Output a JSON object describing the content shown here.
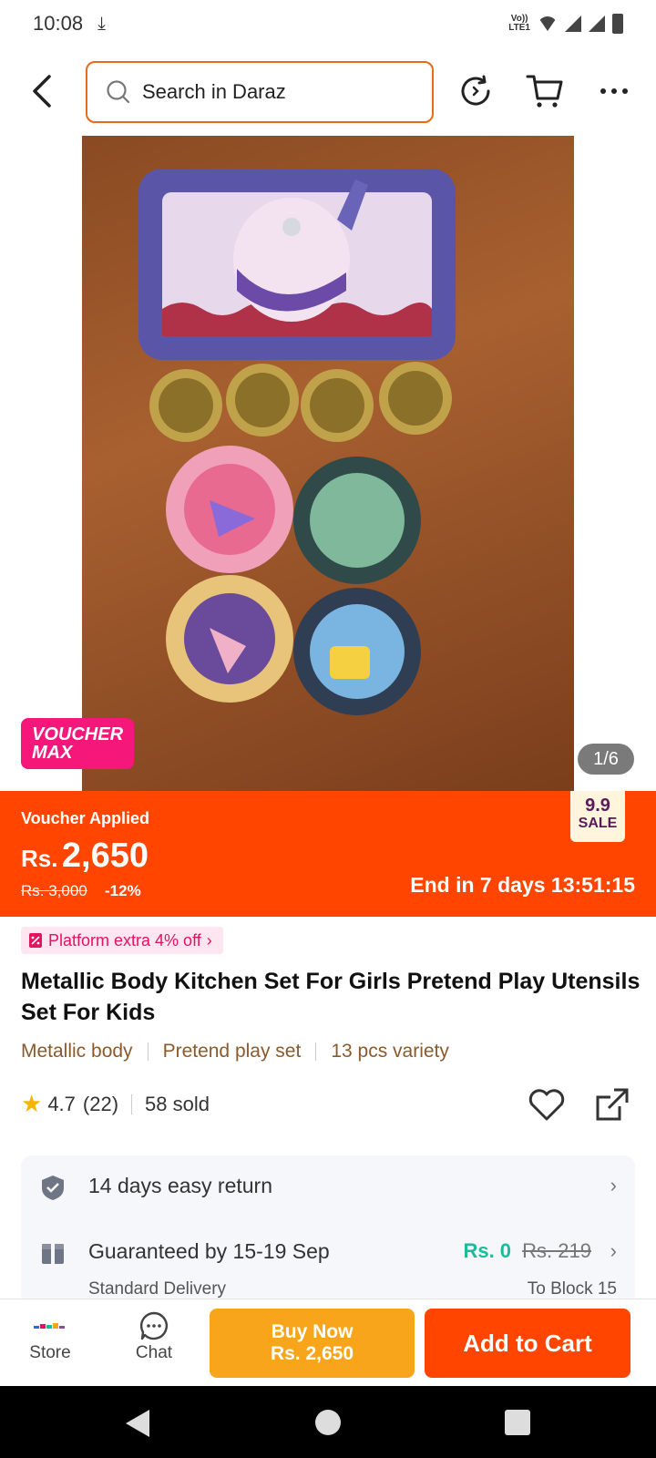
{
  "status_bar": {
    "time": "10:08",
    "network": "Vo)) LTE1"
  },
  "header": {
    "search_placeholder": "Search in Daraz",
    "icons": [
      "back-arrow-icon",
      "search-icon",
      "refresh-icon",
      "cart-icon",
      "more-icon"
    ]
  },
  "gallery": {
    "pager": "1/6",
    "voucher_badge_line1": "VOUCHER",
    "voucher_badge_line2": "MAX"
  },
  "price_banner": {
    "voucher_label": "Voucher Applied",
    "currency": "Rs.",
    "price": "2,650",
    "original_price": "Rs. 3,000",
    "discount": "-12%",
    "countdown": "End in 7 days 13:51:15",
    "sale_badge_top": "9.9",
    "sale_badge_bottom": "SALE",
    "color": "#ff4500"
  },
  "platform_offer": "Platform extra 4% off",
  "product": {
    "title": "Metallic Body Kitchen Set For Girls Pretend Play Utensils Set For Kids",
    "tags": [
      "Metallic body",
      "Pretend play set",
      "13 pcs variety"
    ],
    "rating": "4.7",
    "reviews": "(22)",
    "sold": "58 sold"
  },
  "services": {
    "return_text": "14 days easy return",
    "delivery_text": "Guaranteed by 15-19 Sep",
    "shipping_price": "Rs. 0",
    "shipping_original": "Rs. 219",
    "delivery_type": "Standard Delivery",
    "destination": "To Block 15"
  },
  "action_bar": {
    "store_label": "Store",
    "chat_label": "Chat",
    "buy_now_line1": "Buy Now",
    "buy_now_line2": "Rs. 2,650",
    "add_to_cart": "Add to Cart"
  }
}
